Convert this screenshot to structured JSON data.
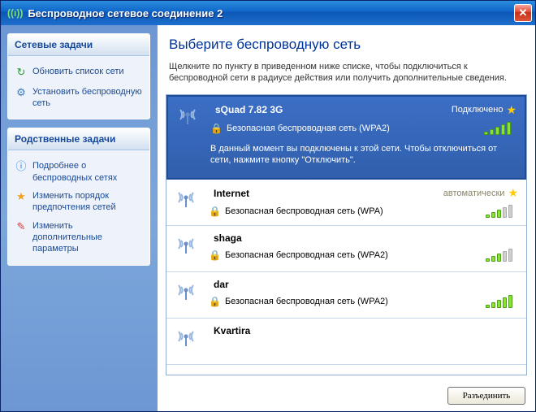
{
  "window": {
    "title": "Беспроводное сетевое соединение 2"
  },
  "sidebar": {
    "tasks_header": "Сетевые задачи",
    "tasks": [
      {
        "icon": "↻",
        "icon_name": "refresh-icon",
        "label": "Обновить список сети"
      },
      {
        "icon": "⚙",
        "icon_name": "adapter-icon",
        "label": "Установить беспроводную сеть"
      }
    ],
    "related_header": "Родственные задачи",
    "related": [
      {
        "icon": "ⓘ",
        "icon_name": "info-icon",
        "label": "Подробнее о беспроводных сетях"
      },
      {
        "icon": "★",
        "icon_name": "star-icon",
        "label": "Изменить порядок предпочтения сетей"
      },
      {
        "icon": "✎",
        "icon_name": "settings-icon",
        "label": "Изменить дополнительные параметры"
      }
    ]
  },
  "main": {
    "title": "Выберите беспроводную сеть",
    "description": "Щелкните по пункту в приведенном ниже списке, чтобы подключиться к беспроводной сети в радиусе действия или получить дополнительные сведения.",
    "disconnect_button": "Разъединить"
  },
  "networks": [
    {
      "name": "sQuad 7.82 3G",
      "status": "Подключено",
      "starred": true,
      "connected": true,
      "security": "Безопасная беспроводная сеть (WPA2)",
      "signal": 5,
      "message": "В данный момент вы подключены к этой сети. Чтобы отключиться от сети, нажмите кнопку \"Отключить\"."
    },
    {
      "name": "Internet",
      "status": "автоматически",
      "starred": true,
      "connected": false,
      "security": "Безопасная беспроводная сеть (WPA)",
      "signal": 3,
      "message": ""
    },
    {
      "name": "shaga",
      "status": "",
      "starred": false,
      "connected": false,
      "security": "Безопасная беспроводная сеть (WPA2)",
      "signal": 3,
      "message": ""
    },
    {
      "name": "dar",
      "status": "",
      "starred": false,
      "connected": false,
      "security": "Безопасная беспроводная сеть (WPA2)",
      "signal": 5,
      "message": ""
    },
    {
      "name": "Kvartira",
      "status": "",
      "starred": false,
      "connected": false,
      "security": "",
      "signal": 0,
      "message": ""
    }
  ]
}
